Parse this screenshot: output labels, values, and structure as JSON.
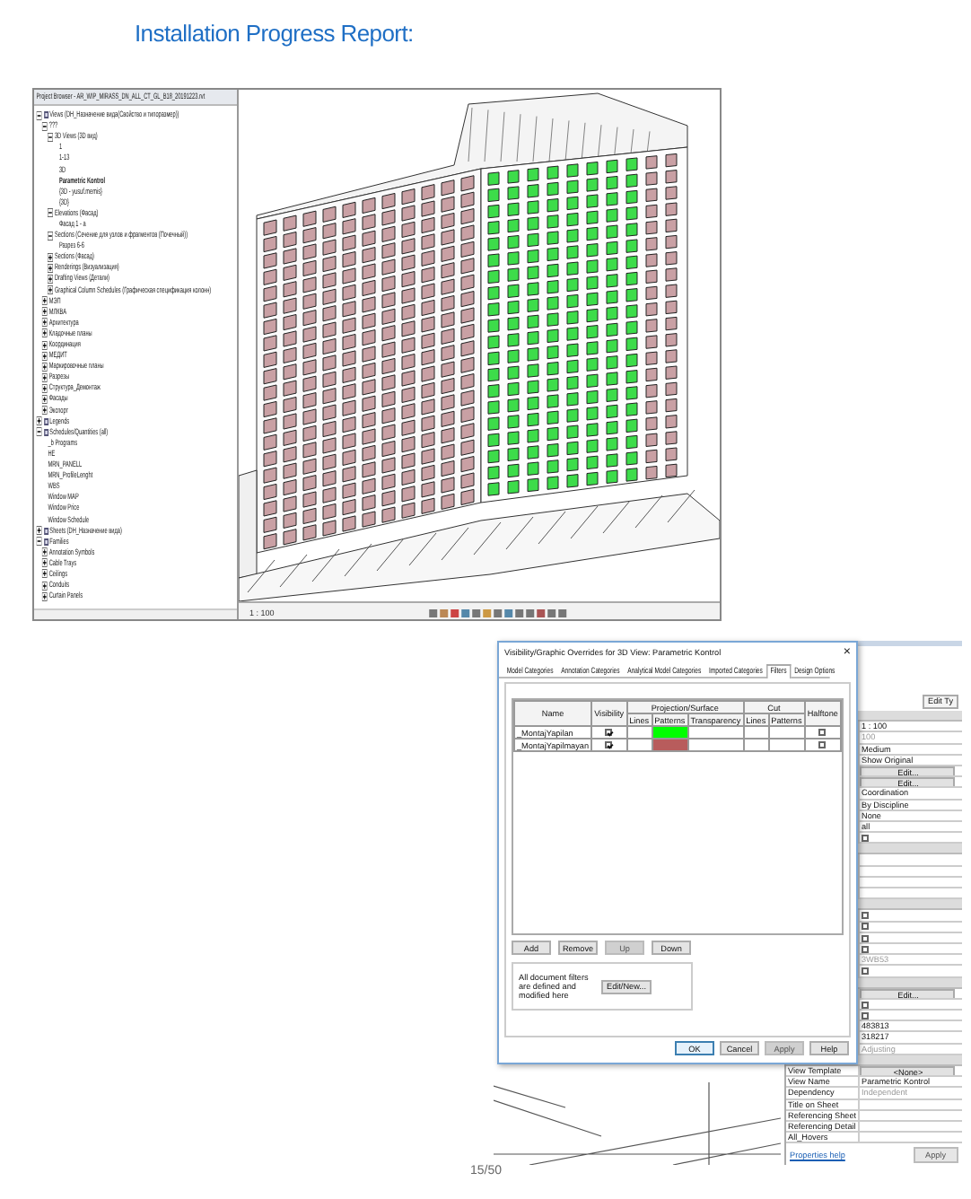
{
  "heading": "Installation Progress Report:",
  "project_browser": {
    "title": "Project Browser - AR_WIP_MIRASS_DN_ALL_CT_GL_B18_20191223.rvt",
    "tree": [
      {
        "label": "Views (DH_Назначение вида(Свойство и типоразмер))",
        "expanded": true,
        "children": [
          {
            "label": "???",
            "expanded": true,
            "children": [
              {
                "label": "3D Views (3D вид)",
                "expanded": true,
                "children": [
                  {
                    "label": "1",
                    "active": false
                  },
                  {
                    "label": "1-13",
                    "active": false
                  },
                  {
                    "label": "3D",
                    "active": false
                  },
                  {
                    "label": "Parametric Kontrol",
                    "active": true
                  },
                  {
                    "label": "{3D - yusuf.memis}",
                    "active": false
                  },
                  {
                    "label": "{3D}",
                    "active": false
                  }
                ]
              },
              {
                "label": "Elevations (Фасад)",
                "expanded": true,
                "children": [
                  {
                    "label": "Фасад 1 - а"
                  }
                ]
              },
              {
                "label": "Sections (Сечение для узлов и фрагментов (Почечный))",
                "expanded": true,
                "children": [
                  {
                    "label": "Разрез 6-6"
                  }
                ]
              },
              {
                "label": "Sections (Фасад)",
                "expanded": false
              },
              {
                "label": "Renderings (Визуализация)",
                "expanded": false
              },
              {
                "label": "Drafting Views (Детали)",
                "expanded": false
              },
              {
                "label": "Graphical Column Schedules (Графическая спецификация колонн)",
                "expanded": false
              }
            ]
          },
          {
            "label": "МЭП",
            "expanded": false
          },
          {
            "label": "МЛКВА",
            "expanded": false
          },
          {
            "label": "Архитектура",
            "expanded": false
          },
          {
            "label": "Кладочные планы",
            "expanded": false
          },
          {
            "label": "Координация",
            "expanded": false
          },
          {
            "label": "МЕДИТ",
            "expanded": false
          },
          {
            "label": "Маркировочные планы",
            "expanded": false
          },
          {
            "label": "Разрезы",
            "expanded": false
          },
          {
            "label": "Структура_Демонтаж",
            "expanded": false
          },
          {
            "label": "Фасады",
            "expanded": false
          },
          {
            "label": "Экспорт",
            "expanded": false
          }
        ]
      },
      {
        "label": "Legends",
        "expanded": false
      },
      {
        "label": "Schedules/Quantities (all)",
        "expanded": true,
        "children": [
          {
            "label": "_b Programs"
          },
          {
            "label": "HE"
          },
          {
            "label": "MRN_PANELL"
          },
          {
            "label": "MRN_ProfileLenght"
          },
          {
            "label": "WBS"
          },
          {
            "label": "Window MAP"
          },
          {
            "label": "Window Price"
          },
          {
            "label": "Window Schedule"
          }
        ]
      },
      {
        "label": "Sheets (DH_Назначение вида)",
        "expanded": false
      },
      {
        "label": "Families",
        "expanded": true,
        "children": [
          {
            "label": "Annotation Symbols",
            "expanded": false
          },
          {
            "label": "Cable Trays",
            "expanded": false
          },
          {
            "label": "Ceilings",
            "expanded": false
          },
          {
            "label": "Conduits",
            "expanded": false
          },
          {
            "label": "Curtain Panels",
            "expanded": false
          }
        ]
      }
    ]
  },
  "model_view": {
    "scale": "1 : 100"
  },
  "vg_dialog": {
    "title": "Visibility/Graphic Overrides for 3D View: Parametric Kontrol",
    "close": "×",
    "tabs": [
      {
        "label": "Model Categories",
        "selected": false
      },
      {
        "label": "Annotation Categories",
        "selected": false
      },
      {
        "label": "Analytical Model Categories",
        "selected": false
      },
      {
        "label": "Imported Categories",
        "selected": false
      },
      {
        "label": "Filters",
        "selected": true
      },
      {
        "label": "Design Options",
        "selected": false
      }
    ],
    "columns": [
      {
        "label": "Name"
      },
      {
        "label": "Visibility"
      },
      {
        "label": "Projection/Surface",
        "sub": [
          "Lines",
          "Patterns",
          "Transparency"
        ]
      },
      {
        "label": "Cut",
        "sub": [
          "Lines",
          "Patterns"
        ]
      },
      {
        "label": "Halftone"
      }
    ],
    "filters": [
      {
        "name": "_MontajYapilan",
        "visible": true,
        "color": "#00ff00",
        "halftone": false
      },
      {
        "name": "_MontajYapilmayan",
        "visible": true,
        "color": "#b85c5c",
        "halftone": false
      }
    ],
    "filter_buttons": [
      {
        "label": "Add",
        "disabled": false
      },
      {
        "label": "Remove",
        "disabled": false
      },
      {
        "label": "Up",
        "disabled": true
      },
      {
        "label": "Down",
        "disabled": false
      }
    ],
    "note": "All document filters are defined and modified here",
    "edit_button": "Edit/New...",
    "dialog_buttons": [
      {
        "label": "OK",
        "default": true,
        "disabled": false
      },
      {
        "label": "Cancel",
        "default": false,
        "disabled": false
      },
      {
        "label": "Apply",
        "default": false,
        "disabled": true
      },
      {
        "label": "Help",
        "default": false,
        "disabled": false
      }
    ]
  },
  "properties": {
    "type_button": "Edit Ty",
    "rows": [
      {
        "kind": "header"
      },
      {
        "kind": "text",
        "value": "1 : 100",
        "dim": false
      },
      {
        "kind": "text",
        "value": "100",
        "dim": true
      },
      {
        "kind": "text",
        "value": "Medium",
        "dim": false
      },
      {
        "kind": "text",
        "value": "Show Original",
        "dim": false
      },
      {
        "kind": "button",
        "value": "Edit..."
      },
      {
        "kind": "button",
        "value": "Edit..."
      },
      {
        "kind": "text",
        "value": "Coordination",
        "dim": false
      },
      {
        "kind": "text",
        "value": "By Discipline",
        "dim": false
      },
      {
        "kind": "text",
        "value": "None",
        "dim": false
      },
      {
        "kind": "text",
        "value": "all",
        "dim": false
      },
      {
        "kind": "checkbox",
        "checked": false
      },
      {
        "kind": "header"
      },
      {
        "kind": "empty"
      },
      {
        "kind": "empty"
      },
      {
        "kind": "empty"
      },
      {
        "kind": "empty"
      },
      {
        "kind": "header"
      },
      {
        "kind": "checkbox",
        "checked": false
      },
      {
        "kind": "checkbox",
        "checked": false
      },
      {
        "kind": "checkbox",
        "checked": false
      },
      {
        "kind": "checkbox",
        "checked": false
      },
      {
        "kind": "text",
        "value": "3WB53",
        "dim": true
      },
      {
        "kind": "checkbox",
        "checked": false
      },
      {
        "kind": "header"
      },
      {
        "kind": "button",
        "value": "Edit..."
      },
      {
        "kind": "checkbox",
        "checked": false
      },
      {
        "kind": "checkbox",
        "checked": false
      },
      {
        "kind": "text",
        "value": "483813",
        "dim": false
      },
      {
        "kind": "text",
        "value": "318217",
        "dim": false
      },
      {
        "kind": "text",
        "value": "Adjusting",
        "dim": true
      },
      {
        "kind": "header"
      },
      {
        "kind": "button",
        "value": "<None>",
        "label": "View Template"
      },
      {
        "kind": "text",
        "value": "Parametric Kontrol",
        "dim": false,
        "label": "View Name"
      },
      {
        "kind": "text",
        "value": "Independent",
        "dim": true,
        "label": "Dependency"
      },
      {
        "kind": "empty",
        "label": "Title on Sheet"
      },
      {
        "kind": "empty",
        "label": "Referencing Sheet"
      },
      {
        "kind": "empty",
        "label": "Referencing Detail"
      },
      {
        "kind": "empty",
        "label": "All_Hovers"
      }
    ],
    "help_link": "Properties help",
    "apply_button": "Apply"
  },
  "page_number": "15/50"
}
